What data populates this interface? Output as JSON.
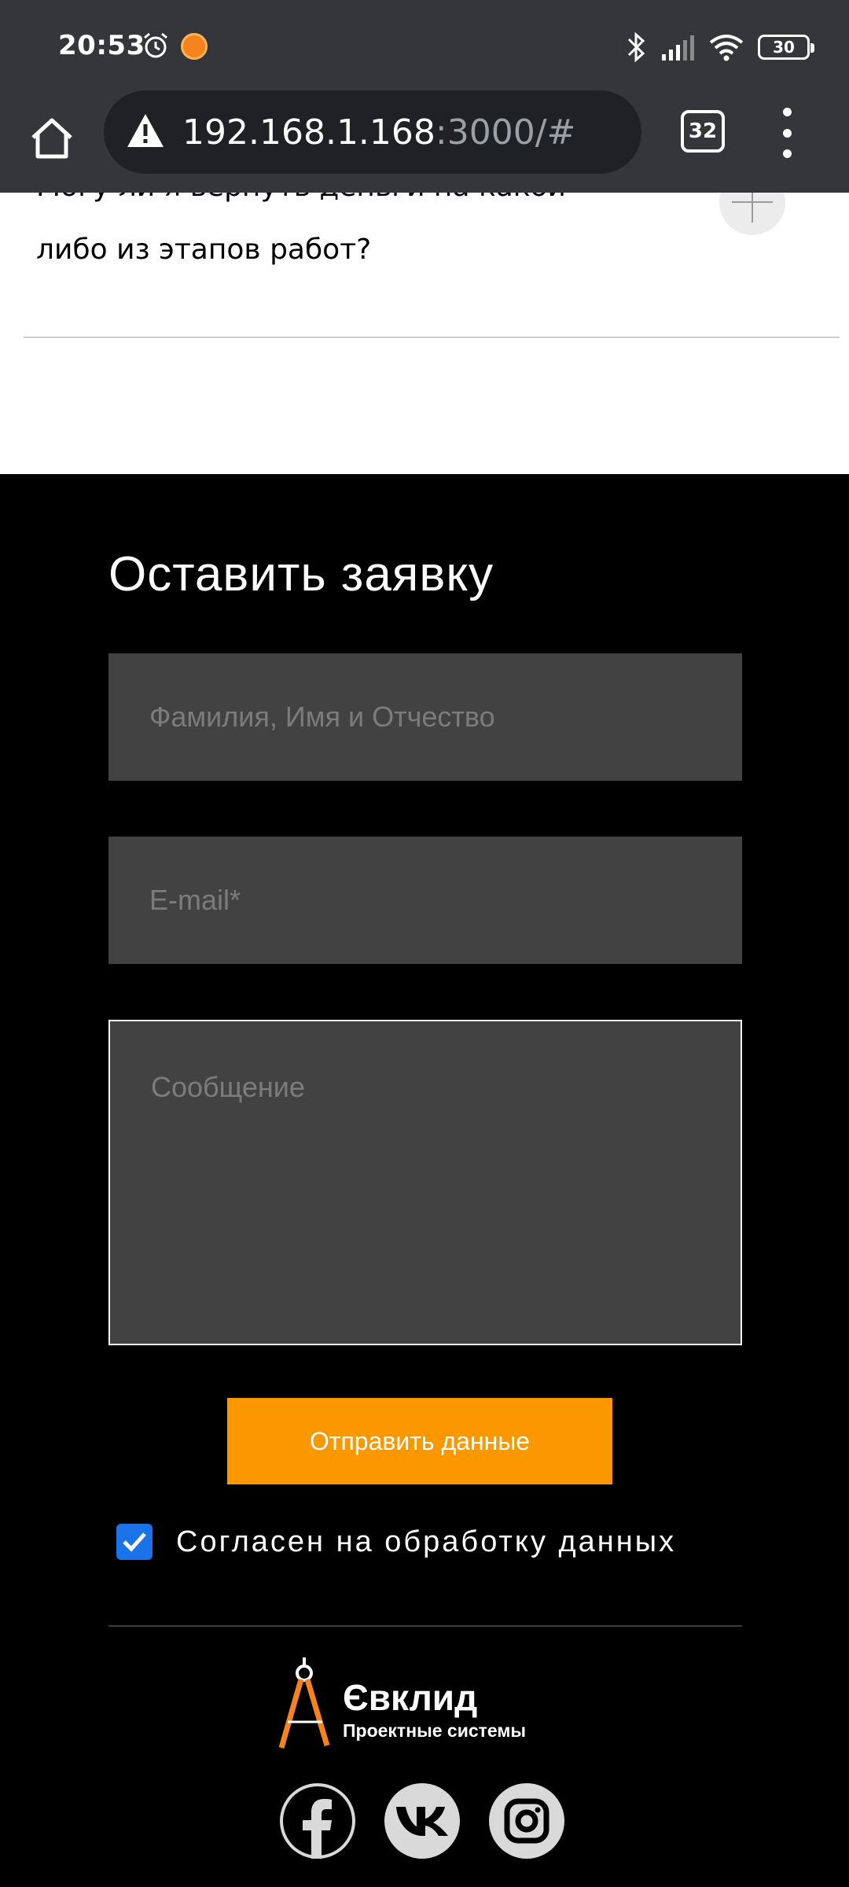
{
  "status_bar": {
    "time": "20:53",
    "battery": "30",
    "icons": [
      "alarm-icon",
      "app-notification-icon",
      "bluetooth-icon",
      "signal-icon",
      "wifi-icon",
      "battery-icon"
    ]
  },
  "browser": {
    "url_host": "192.168.1.168",
    "url_rest": ":3000/#",
    "tab_count": "32",
    "icons": [
      "home-icon",
      "not-secure-warning-icon",
      "tabs-icon",
      "more-menu-icon"
    ]
  },
  "faq": {
    "question_line1": "Могу ли я вернуть деньги на какой-",
    "question_line2": "либо из этапов работ?"
  },
  "form": {
    "title": "Оставить заявку",
    "name_placeholder": "Фамилия, Имя и Отчество",
    "email_placeholder": "E-mail*",
    "message_placeholder": "Сообщение",
    "submit_label": "Отправить данные",
    "consent_label": "Согласен на обработку данных",
    "consent_checked": true
  },
  "footer": {
    "logo_name": "Євклид",
    "logo_subtitle": "Проектные системы",
    "social": [
      "facebook-icon",
      "vk-icon",
      "instagram-icon"
    ]
  },
  "colors": {
    "accent": "#fb9800",
    "checkbox": "#1a73e8",
    "chrome_bar": "#35363a",
    "field_bg": "#424242"
  }
}
